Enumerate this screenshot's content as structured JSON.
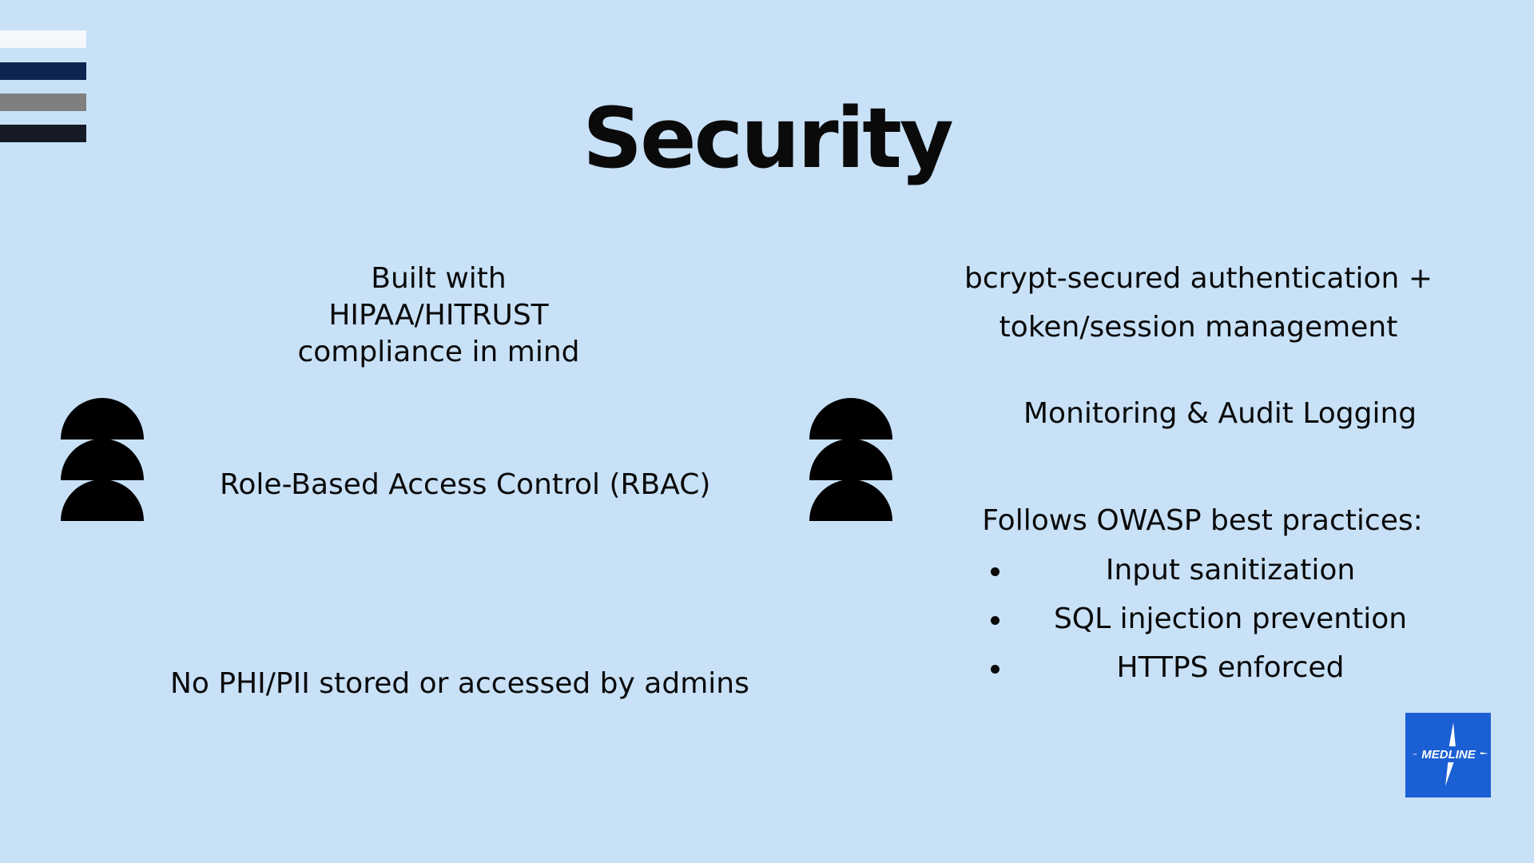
{
  "slide": {
    "title": "Security",
    "colors": {
      "background": "#c8e1f7",
      "stripe_colors": [
        "#f4f7fb",
        "#0f2550",
        "#7f7f7f",
        "#151a25"
      ],
      "logo_bg": "#1a5fd4"
    },
    "left": {
      "compliance_line1": "Built with",
      "compliance_line2": "HIPAA/HITRUST",
      "compliance_line3": "compliance in mind",
      "rbac": "Role-Based Access Control (RBAC)",
      "no_phi": "No PHI/PII stored or accessed by admins"
    },
    "right": {
      "auth_line1": "bcrypt-secured authentication +",
      "auth_line2": "token/session management",
      "monitoring": "Monitoring & Audit Logging",
      "owasp_heading": "Follows OWASP best practices:",
      "owasp_items": [
        "Input sanitization",
        "SQL injection prevention",
        "HTTPS enforced"
      ]
    },
    "icons": {
      "decorative_stripes": "stripes-icon",
      "stacked_semicircles": "stacked-semicircles-icon",
      "brand_logo": "medline-logo"
    },
    "logo_text": "MEDLINE"
  }
}
